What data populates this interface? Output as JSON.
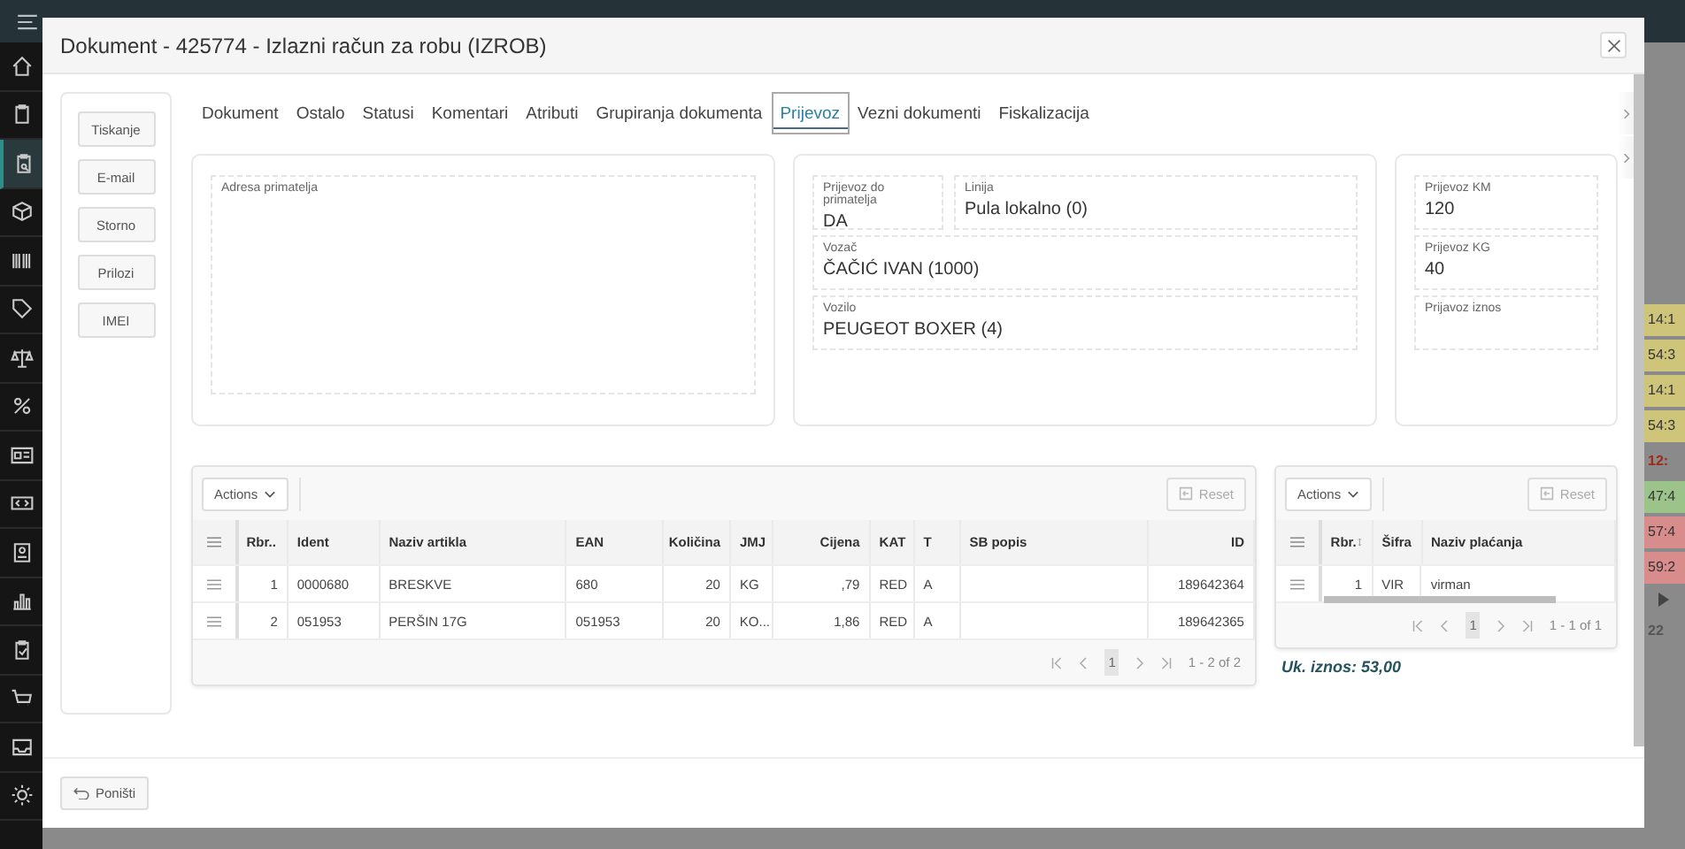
{
  "nav_items": [
    {
      "selected": false
    },
    {
      "selected": false
    },
    {
      "selected": true
    },
    {
      "selected": false
    },
    {
      "selected": false
    },
    {
      "selected": false
    },
    {
      "selected": false
    },
    {
      "selected": false
    },
    {
      "selected": false
    },
    {
      "selected": false
    },
    {
      "selected": false
    },
    {
      "selected": false
    },
    {
      "selected": false
    },
    {
      "selected": false
    },
    {
      "selected": false
    },
    {
      "selected": false
    }
  ],
  "background_strip": [
    {
      "kind": "cell",
      "text": "14:1",
      "color": "#cfc57a"
    },
    {
      "kind": "cell",
      "text": "54:3",
      "color": "#cfc57a"
    },
    {
      "kind": "cell",
      "text": "14:1",
      "color": "#cfc57a"
    },
    {
      "kind": "cell",
      "text": "54:3",
      "color": "#cfc57a"
    },
    {
      "kind": "text",
      "text": "12:",
      "color": "#a02a1a"
    },
    {
      "kind": "cell",
      "text": "47:4",
      "color": "#9cc48a"
    },
    {
      "kind": "cell",
      "text": "57:4",
      "color": "#d98c8c"
    },
    {
      "kind": "cell",
      "text": "59:2",
      "color": "#d98c8c"
    },
    {
      "kind": "play"
    },
    {
      "kind": "text",
      "text": "22",
      "color": "#555555"
    }
  ],
  "dialog": {
    "title": "Dokument - 425774 - Izlazni račun za robu (IZROB)"
  },
  "side_buttons": [
    "Tiskanje",
    "E-mail",
    "Storno",
    "Prilozi",
    "IMEI"
  ],
  "tabs": [
    {
      "label": "Dokument",
      "selected": false
    },
    {
      "label": "Ostalo",
      "selected": false
    },
    {
      "label": "Statusi",
      "selected": false
    },
    {
      "label": "Komentari",
      "selected": false
    },
    {
      "label": "Atributi",
      "selected": false
    },
    {
      "label": "Grupiranja dokumenta",
      "selected": false
    },
    {
      "label": "Prijevoz",
      "selected": true
    },
    {
      "label": "Vezni dokumenti",
      "selected": false
    },
    {
      "label": "Fiskalizacija",
      "selected": false
    }
  ],
  "address": {
    "label": "Adresa primatelja"
  },
  "transport_fields": [
    {
      "label": "Prijevoz do primatelja",
      "value": "DA"
    },
    {
      "label": "Linija",
      "value": "Pula lokalno (0)"
    },
    {
      "label": "Vozač",
      "value": "ČAČIĆ IVAN (1000)"
    },
    {
      "label": "Vozilo",
      "value": "PEUGEOT BOXER (4)"
    }
  ],
  "amount_fields": [
    {
      "label": "Prijevoz KM",
      "value": "120"
    },
    {
      "label": "Prijevoz KG",
      "value": "40"
    },
    {
      "label": "Prijavoz iznos"
    }
  ],
  "items_table": {
    "actions": "Actions",
    "reset": {
      "label": "Reset",
      "disabled": true
    },
    "columns": [
      "Rbr..",
      "Ident",
      "Naziv artikla",
      "EAN",
      "Količina",
      "JMJ",
      "Cijena",
      "KAT",
      "T",
      "SB popis",
      "ID"
    ],
    "rows": [
      {
        "cells": [
          "1",
          "0000680",
          "BRESKVE",
          "680",
          "20",
          "KG",
          ",79",
          "RED",
          "A",
          "",
          "189642364"
        ]
      },
      {
        "cells": [
          "2",
          "051953",
          "PERŠIN 17G",
          "051953",
          "20",
          "KO...",
          "1,86",
          "RED",
          "A",
          "",
          "189642365"
        ]
      }
    ],
    "page": "1",
    "range": "1 - 2 of 2"
  },
  "payments_table": {
    "actions": "Actions",
    "reset": {
      "label": "Reset",
      "disabled": true
    },
    "columns": [
      "Rbr.",
      "Šifra",
      "Naziv plaćanja"
    ],
    "rows": [
      {
        "cells": [
          "1",
          "VIR",
          "virman"
        ]
      }
    ],
    "page": "1",
    "range": "1 - 1 of 1"
  },
  "total": "Uk. iznos: 53,00",
  "cancel_button": "Poništi"
}
